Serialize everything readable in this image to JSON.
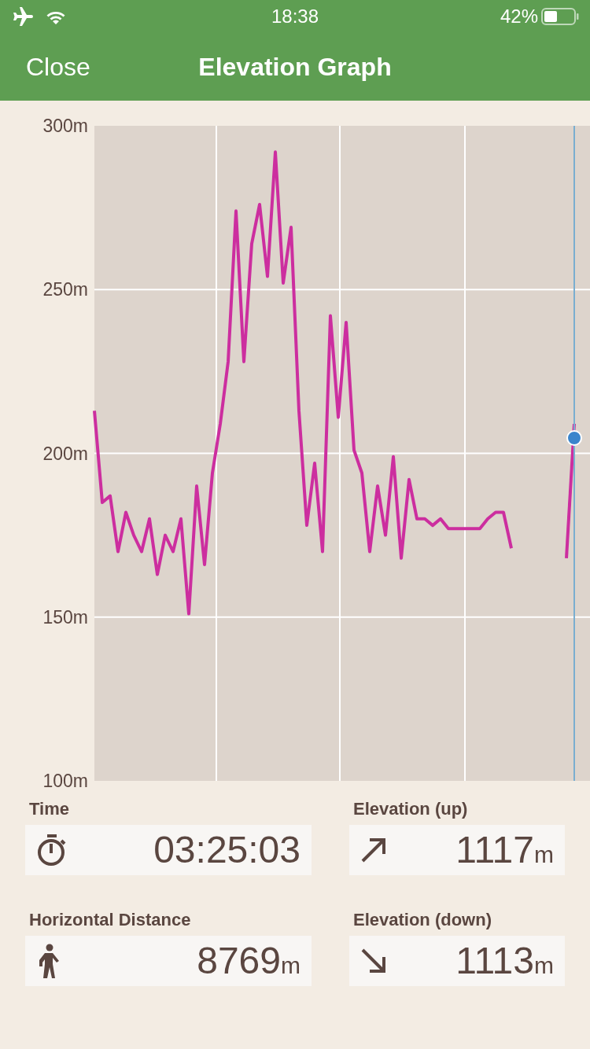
{
  "status_bar": {
    "time": "18:38",
    "battery": "42%"
  },
  "nav": {
    "close": "Close",
    "title": "Elevation Graph"
  },
  "chart": {
    "chart_data": {
      "type": "line",
      "grid": true,
      "ylim": [
        100,
        300
      ],
      "yticks": [
        {
          "value": 100,
          "label": "100m"
        },
        {
          "value": 150,
          "label": "150m"
        },
        {
          "value": 200,
          "label": "200m"
        },
        {
          "value": 250,
          "label": "250m"
        },
        {
          "value": 300,
          "label": "300m"
        }
      ],
      "categories": [
        null,
        null,
        null,
        null,
        null,
        null,
        null,
        null,
        null,
        null,
        null,
        null,
        null,
        null,
        null,
        null,
        null,
        null,
        null,
        null,
        null,
        null,
        null,
        null,
        null,
        null,
        null,
        null,
        null,
        null,
        null,
        null,
        null,
        null,
        null,
        null,
        null,
        null,
        null,
        null,
        null,
        null,
        null,
        null,
        null,
        null,
        null,
        null,
        null,
        null,
        null,
        null,
        null,
        null,
        null,
        null,
        null,
        null,
        null,
        null,
        null,
        null,
        null,
        null
      ],
      "series": [
        {
          "color": "#cc2e9f",
          "values": [
            213,
            185,
            187,
            170,
            182,
            175,
            170,
            180,
            163,
            175,
            170,
            180,
            151,
            190,
            166,
            194,
            209,
            228,
            274,
            228,
            264,
            276,
            254,
            292,
            252,
            269,
            213,
            178,
            197,
            170,
            242,
            211,
            240,
            201,
            194,
            170,
            190,
            175,
            199,
            168,
            192,
            180,
            180,
            178,
            180,
            177,
            177,
            177,
            177,
            177,
            180,
            182,
            182,
            171,
            null,
            null,
            null,
            null,
            null,
            null,
            null,
            null,
            null,
            null
          ]
        },
        {
          "color": "#cc2e9f",
          "values": [
            null,
            null,
            null,
            null,
            null,
            null,
            null,
            null,
            null,
            null,
            null,
            null,
            null,
            null,
            null,
            null,
            null,
            null,
            null,
            null,
            null,
            null,
            null,
            null,
            null,
            null,
            null,
            null,
            null,
            null,
            null,
            null,
            null,
            null,
            null,
            null,
            null,
            null,
            null,
            null,
            null,
            null,
            null,
            null,
            null,
            null,
            null,
            null,
            null,
            null,
            null,
            null,
            null,
            null,
            null,
            null,
            null,
            null,
            null,
            null,
            168,
            209,
            null,
            null
          ]
        }
      ]
    }
  },
  "stats": [
    {
      "label": "Time",
      "kind": "duration",
      "value": "03:25:03"
    },
    {
      "label": "Elevation (up)",
      "kind": "ascent",
      "value": "1117",
      "unit": "m"
    },
    {
      "label": "Horizontal Distance",
      "kind": "distance",
      "value": "8769",
      "unit": "m"
    },
    {
      "label": "Elevation (down)",
      "kind": "descent",
      "value": "1113",
      "unit": "m"
    }
  ]
}
